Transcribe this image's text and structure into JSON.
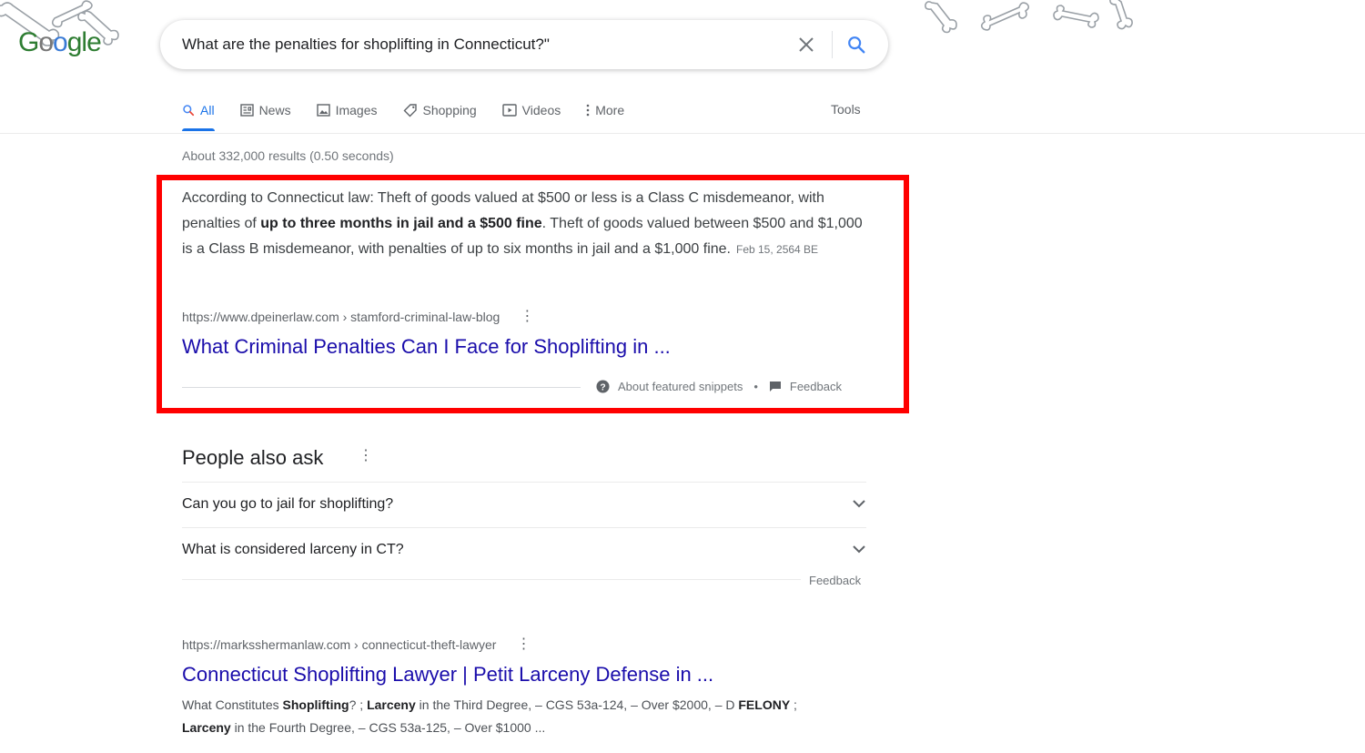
{
  "header": {
    "logo_text": "Google",
    "search_query": "What are the penalties for shoplifting in Connecticut?\""
  },
  "tabs": [
    {
      "label": "All",
      "icon": "search-icon",
      "active": true
    },
    {
      "label": "News",
      "icon": "news-icon",
      "active": false
    },
    {
      "label": "Images",
      "icon": "image-icon",
      "active": false
    },
    {
      "label": "Shopping",
      "icon": "tag-icon",
      "active": false
    },
    {
      "label": "Videos",
      "icon": "video-icon",
      "active": false
    },
    {
      "label": "More",
      "icon": "more-vert-icon",
      "active": false
    }
  ],
  "tools_label": "Tools",
  "result_stats": "About 332,000 results (0.50 seconds)",
  "featured_snippet": {
    "text_1": "According to Connecticut law: Theft of goods valued at $500 or less is a Class C misdemeanor, with penalties of ",
    "text_bold": "up to three months in jail and a $500 fine",
    "text_2": ". Theft of goods valued between $500 and $1,000 is a Class B misdemeanor, with penalties of up to six months in jail and a $1,000 fine.",
    "date": "Feb 15, 2564 BE",
    "url": "https://www.dpeinerlaw.com › stamford-criminal-law-blog",
    "title": "What Criminal Penalties Can I Face for Shoplifting in ...",
    "about_label": "About featured snippets",
    "separator": "•",
    "feedback_label": "Feedback"
  },
  "people_also_ask": {
    "title": "People also ask",
    "questions": [
      "Can you go to jail for shoplifting?",
      "What is considered larceny in CT?"
    ],
    "feedback_label": "Feedback"
  },
  "result": {
    "url": "https://marksshermanlaw.com › connecticut-theft-lawyer",
    "title": "Connecticut Shoplifting Lawyer | Petit Larceny Defense in ...",
    "snip_a": "What Constitutes ",
    "snip_b": "Shoplifting",
    "snip_c": "? ; ",
    "snip_d": "Larceny",
    "snip_e": " in the Third Degree, – CGS 53a-124, – Over $2000, – D ",
    "snip_f": "FELONY",
    "snip_g": " ; ",
    "snip_h": "Larceny",
    "snip_i": " in the Fourth Degree, – CGS 53a-125, – Over $1000 ..."
  },
  "colors": {
    "highlight_frame": "#ff0000",
    "link": "#1a0dab",
    "accent": "#1a73e8"
  }
}
